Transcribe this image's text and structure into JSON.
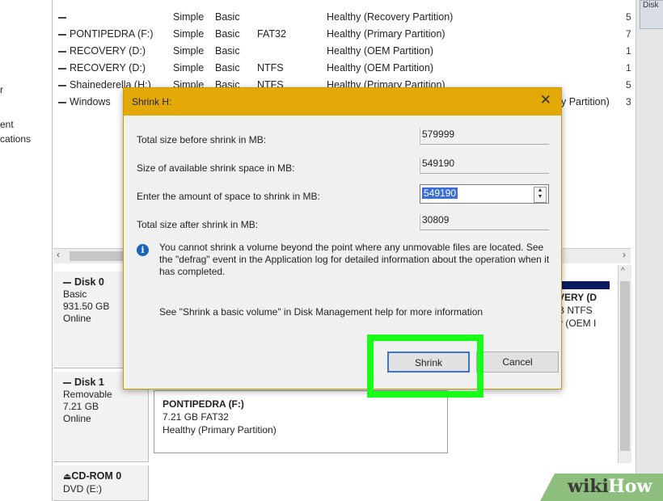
{
  "left_nav": {
    "items": [
      "r",
      "ent",
      "cations"
    ]
  },
  "volumes": [
    {
      "name": "",
      "layout": "Simple",
      "type": "Basic",
      "fs": "",
      "status": "Healthy (Recovery Partition)",
      "right": "5"
    },
    {
      "name": "PONTIPEDRA (F:)",
      "layout": "Simple",
      "type": "Basic",
      "fs": "FAT32",
      "status": "Healthy (Primary Partition)",
      "right": "7"
    },
    {
      "name": "RECOVERY (D:)",
      "layout": "Simple",
      "type": "Basic",
      "fs": "",
      "status": "Healthy (OEM Partition)",
      "right": "1"
    },
    {
      "name": "RECOVERY (D:)",
      "layout": "Simple",
      "type": "Basic",
      "fs": "NTFS",
      "status": "Healthy (OEM Partition)",
      "right": "1"
    },
    {
      "name": "Shainederella (H:)",
      "layout": "Simple",
      "type": "Basic",
      "fs": "NTFS",
      "status": "Healthy (Primary Partition)",
      "right": "5"
    },
    {
      "name": "Windows",
      "layout": "",
      "type": "",
      "fs": "",
      "status": "y Partition)",
      "right": "3"
    }
  ],
  "right_strip": {
    "button": "Disk"
  },
  "disks": [
    {
      "title": "Disk 0",
      "type": "Basic",
      "size": "931.50 GB",
      "state": "Online"
    },
    {
      "title": "Disk 1",
      "type": "Removable",
      "size": "7.21 GB",
      "state": "Online"
    },
    {
      "title": "CD-ROM 0",
      "type": "DVD (E:)",
      "size": "",
      "state": ""
    }
  ],
  "disk1_partition": {
    "name": "PONTIPEDRA (F:)",
    "size": "7.21 GB FAT32",
    "status": "Healthy (Primary Partition)"
  },
  "disk0_right_partition": {
    "line1": "VERY (D",
    "line2": "B NTFS",
    "line3": "y (OEM I"
  },
  "dialog": {
    "title": "Shrink H:",
    "close": "✕",
    "rows": [
      {
        "label": "Total size before shrink in MB:",
        "value": "579999"
      },
      {
        "label": "Size of available shrink space in MB:",
        "value": "549190"
      },
      {
        "label": "Enter the amount of space to shrink in MB:",
        "value": "549190"
      },
      {
        "label": "Total size after shrink in MB:",
        "value": "30809"
      }
    ],
    "info": "You cannot shrink a volume beyond the point where any unmovable files are located. See the \"defrag\" event in the Application log for detailed information about the operation when it has completed.",
    "help": "See \"Shrink a basic volume\" in Disk Management help for more information",
    "shrink_button": "Shrink",
    "cancel_button": "Cancel"
  },
  "watermark": {
    "part1": "wiki",
    "part2": "How"
  },
  "colors": {
    "dialog_title": "#e3a909",
    "highlight": "#19ff19",
    "selection": "#3a6fd6",
    "partition_bar": "#0a1a5c"
  }
}
